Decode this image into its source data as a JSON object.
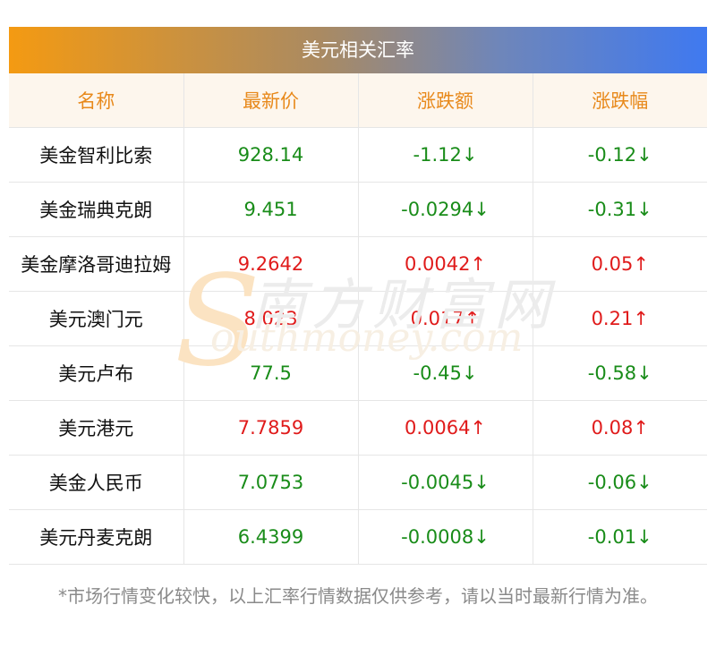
{
  "title": "美元相关汇率",
  "headers": {
    "name": "名称",
    "price": "最新价",
    "change": "涨跌额",
    "pct": "涨跌幅"
  },
  "rows": [
    {
      "name": "美金智利比索",
      "price": "928.14",
      "change": "-1.12↓",
      "pct": "-0.12↓",
      "dir": "down"
    },
    {
      "name": "美金瑞典克朗",
      "price": "9.451",
      "change": "-0.0294↓",
      "pct": "-0.31↓",
      "dir": "down"
    },
    {
      "name": "美金摩洛哥迪拉姆",
      "price": "9.2642",
      "change": "0.0042↑",
      "pct": "0.05↑",
      "dir": "up"
    },
    {
      "name": "美元澳门元",
      "price": "8.023",
      "change": "0.017↑",
      "pct": "0.21↑",
      "dir": "up"
    },
    {
      "name": "美元卢布",
      "price": "77.5",
      "change": "-0.45↓",
      "pct": "-0.58↓",
      "dir": "down"
    },
    {
      "name": "美元港元",
      "price": "7.7859",
      "change": "0.0064↑",
      "pct": "0.08↑",
      "dir": "up"
    },
    {
      "name": "美金人民币",
      "price": "7.0753",
      "change": "-0.0045↓",
      "pct": "-0.06↓",
      "dir": "down"
    },
    {
      "name": "美元丹麦克朗",
      "price": "6.4399",
      "change": "-0.0008↓",
      "pct": "-0.01↓",
      "dir": "down"
    }
  ],
  "watermark": {
    "cn": "南方财富网",
    "en": "outhmoney.com",
    "s": "S"
  },
  "footnote": "*市场行情变化较快，以上汇率行情数据仅供参考，请以当时最新行情为准。",
  "colors": {
    "up": "#e01b1b",
    "down": "#198c19",
    "header_text": "#e8891b",
    "header_bg": "#fdf6ed",
    "gradient_start": "#f49a12",
    "gradient_end": "#3f79f0"
  }
}
